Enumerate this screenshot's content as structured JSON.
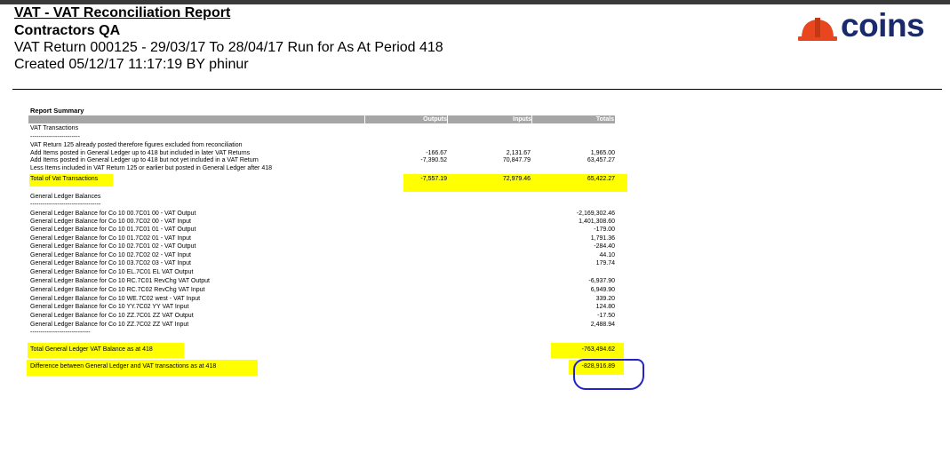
{
  "header": {
    "title": "VAT - VAT Reconciliation Report",
    "company": "Contractors QA",
    "subtitle": "VAT Return 000125 - 29/03/17 To 28/04/17 Run for As At Period 418",
    "created": "Created 05/12/17 11:17:19 BY phinur"
  },
  "logo": {
    "text": "coins",
    "brand_color": "#1b2a6b",
    "hat_color": "#e8461e"
  },
  "report": {
    "section_title": "Report Summary",
    "columns": {
      "outputs": "Outputs",
      "inputs": "Inputs",
      "totals": "Totals"
    },
    "vat_section": "VAT Transactions",
    "dashes1": "------------------------",
    "note": "VAT Return 125 already posted therefore figures excluded from reconciliation",
    "vat_rows": [
      {
        "label": "Add Items posted in General Ledger up to 418 but included in later VAT Returns",
        "outputs": "-166.67",
        "inputs": "2,131.67",
        "totals": "1,965.00"
      },
      {
        "label": "Add Items posted in General Ledger up to 418 but not yet included in a VAT Return",
        "outputs": "-7,390.52",
        "inputs": "70,847.79",
        "totals": "63,457.27"
      },
      {
        "label": "Less Items included in VAT Return 125 or earlier but posted in General Ledger after 418",
        "outputs": "",
        "inputs": "",
        "totals": ""
      }
    ],
    "vat_total": {
      "label": "Total of Vat Transactions",
      "outputs": "-7,557.19",
      "inputs": "72,979.46",
      "totals": "65,422.27"
    },
    "gl_section": "General Ledger Balances",
    "dashes2": "----------------------------------",
    "gl_rows": [
      {
        "label": "General Ledger Balance for Co 10 00.7C01 00 - VAT Output",
        "totals": "-2,169,302.46"
      },
      {
        "label": "General Ledger Balance for Co 10 00.7C02 00 - VAT Input",
        "totals": "1,401,308.60"
      },
      {
        "label": "General Ledger Balance for Co 10 01.7C01 01 - VAT Output",
        "totals": "-179.00"
      },
      {
        "label": "General Ledger Balance for Co 10 01.7C02 01 - VAT Input",
        "totals": "1,791.36"
      },
      {
        "label": "General Ledger Balance for Co 10 02.7C01 02 - VAT Output",
        "totals": "-284.40"
      },
      {
        "label": "General Ledger Balance for Co 10 02.7C02 02 - VAT Input",
        "totals": "44.10"
      },
      {
        "label": "General Ledger Balance for Co 10 03.7C02 03 - VAT Input",
        "totals": "179.74"
      },
      {
        "label": "General Ledger Balance for Co 10 EL.7C01 EL VAT Output",
        "totals": ""
      },
      {
        "label": "General Ledger Balance for Co 10 RC.7C01 RevChg VAT Output",
        "totals": "-6,937.90"
      },
      {
        "label": "General Ledger Balance for Co 10 RC.7C02 RevChg VAT Input",
        "totals": "6,949.90"
      },
      {
        "label": "General Ledger Balance for Co 10 WE.7C02 west - VAT Input",
        "totals": "339.20"
      },
      {
        "label": "General Ledger Balance for Co 10 YY.7C02 YY VAT Input",
        "totals": "124.80"
      },
      {
        "label": "General Ledger Balance for Co 10 ZZ.7C01 ZZ VAT Output",
        "totals": "-17.50"
      },
      {
        "label": "General Ledger Balance for Co 10 ZZ.7C02 ZZ VAT Input",
        "totals": "2,488.94"
      }
    ],
    "dashes3": "-----------------------------",
    "gl_total": {
      "label": "Total General Ledger VAT Balance as at 418",
      "totals": "-763,494.62"
    },
    "difference": {
      "label": "Difference between General Ledger and VAT transactions as at 418",
      "totals": "-828,916.89"
    }
  },
  "colors": {
    "highlight": "#ffff00",
    "annotation_circle": "#2222cc",
    "column_header_bg": "#a6a6a6"
  }
}
